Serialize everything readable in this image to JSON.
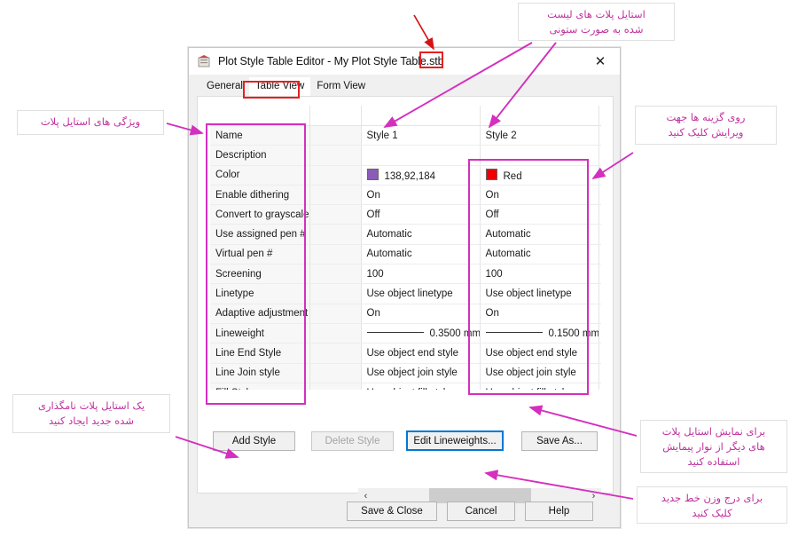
{
  "window": {
    "title": "Plot Style Table Editor - My Plot Style Table.stb",
    "icon": "plot-style-table-icon",
    "close_label": "✕"
  },
  "tabs": [
    {
      "label": "General",
      "active": false
    },
    {
      "label": "Table View",
      "active": true
    },
    {
      "label": "Form View",
      "active": false
    }
  ],
  "table": {
    "properties": [
      "Name",
      "Description",
      "Color",
      "Enable dithering",
      "Convert to grayscale",
      "Use assigned pen #",
      "Virtual pen #",
      "Screening",
      "Linetype",
      "Adaptive adjustment",
      "Lineweight",
      "Line End Style",
      "Line Join style",
      "Fill Style"
    ],
    "columns": [
      {
        "header": "",
        "name": "Style 1",
        "color_swatch": "#8a5cb8",
        "color_label": "138,92,184",
        "values": [
          "Style 1",
          "",
          "138,92,184",
          "On",
          "Off",
          "Automatic",
          "Automatic",
          "100",
          "Use object linetype",
          "On",
          "0.3500 mm",
          "Use object end style",
          "Use object join style",
          "Use object fill style"
        ]
      },
      {
        "header": "",
        "name": "Style 2",
        "color_swatch": "#ee0000",
        "color_label": "Red",
        "values": [
          "Style 2",
          "",
          "Red",
          "On",
          "Off",
          "Automatic",
          "Automatic",
          "100",
          "Use object linetype",
          "On",
          "0.1500 mm",
          "Use object end style",
          "Use object join style",
          "Use object fill style"
        ]
      }
    ]
  },
  "scrollbar": {
    "left_arrow": "‹",
    "right_arrow": "›"
  },
  "buttons": {
    "add_style": "Add Style",
    "delete_style": "Delete Style",
    "edit_lineweights": "Edit Lineweights...",
    "save_as": "Save As...",
    "save_close": "Save & Close",
    "cancel": "Cancel",
    "help": "Help"
  },
  "annotations": {
    "plot_style_properties": "ویژگی های استایل پلات",
    "listed_styles_columns": "استایل پلات های لیست\nشده به صورت ستونی",
    "click_to_edit": "روی گزینه ها جهت\nویرایش کلیک کنید",
    "create_new_style": "یک استایل پلات نامگذاری\nشده جدید ایجاد کنید",
    "use_scrollbar": "برای نمایش استایل پلات\nهای دیگر از نوار پیمایش\nاستفاده کنید",
    "add_lineweight": "برای درج وزن خط جدید\nکلیک کنید"
  },
  "colors": {
    "annotation_text": "#c0309e",
    "annotation_arrow": "#d42fbe",
    "highlight_box": "#d42fbe",
    "red_highlight": "#e52020",
    "focus_border": "#0078d7"
  }
}
